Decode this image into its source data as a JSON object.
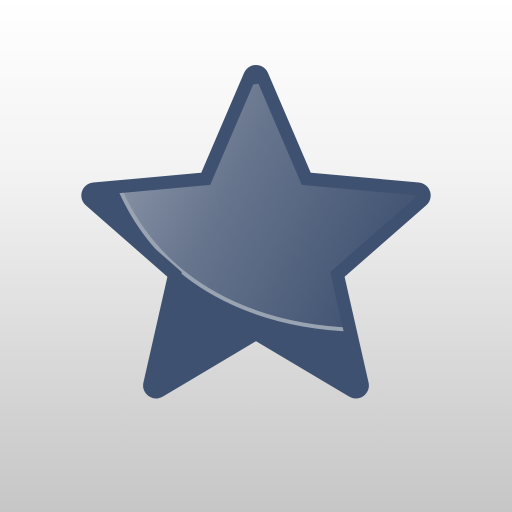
{
  "icon": {
    "name": "star-icon",
    "colors": {
      "star_fill": "#3e5170",
      "gloss_light": "#b8bec9",
      "background_top": "#ffffff",
      "background_bottom": "#c6c6c6"
    }
  }
}
